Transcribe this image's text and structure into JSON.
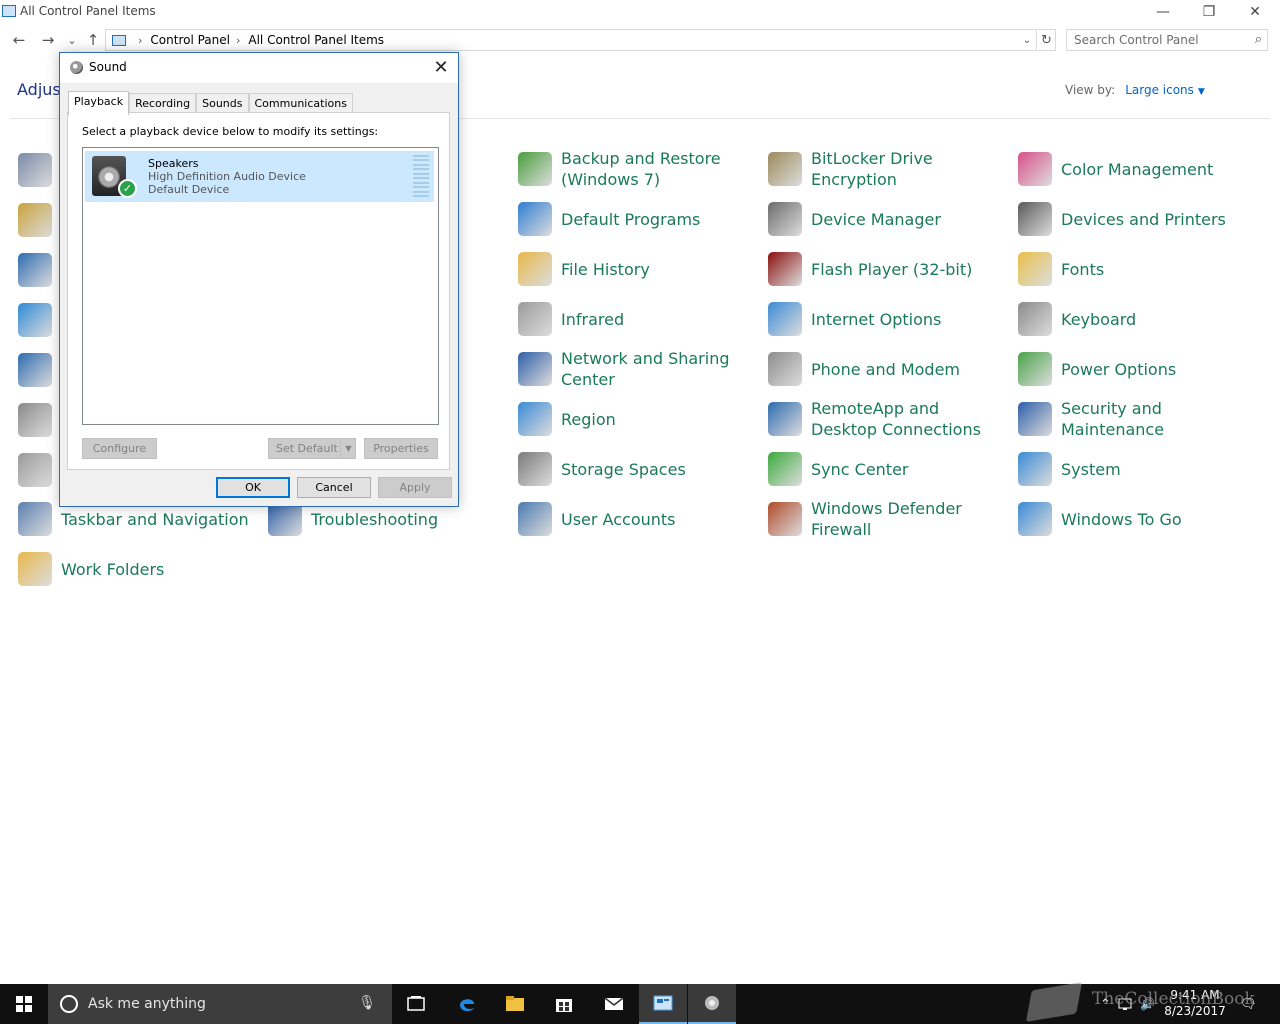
{
  "window": {
    "title": "All Control Panel Items",
    "minimize_glyph": "—",
    "restore_glyph": "❐",
    "close_glyph": "✕"
  },
  "nav": {
    "back_glyph": "←",
    "forward_glyph": "→",
    "recent_glyph": "⌄",
    "up_glyph": "↑",
    "breadcrumb": [
      "Control Panel",
      "All Control Panel Items"
    ],
    "dropdown_glyph": "⌄",
    "refresh_glyph": "↻",
    "search_placeholder": "Search Control Panel",
    "search_glyph": "⌕"
  },
  "header": {
    "adjust_text": "Adjust",
    "view_by_label": "View by:",
    "view_by_value": "Large icons"
  },
  "items": [
    {
      "label": "Backup and Restore (Windows 7)",
      "icon": "backup-restore-icon",
      "color": "#4a9e3c"
    },
    {
      "label": "BitLocker Drive Encryption",
      "icon": "bitlocker-icon",
      "color": "#9a8a5a"
    },
    {
      "label": "Color Management",
      "icon": "color-management-icon",
      "color": "#d94f8a"
    },
    {
      "label": "Default Programs",
      "icon": "default-programs-icon",
      "color": "#2d7dd2"
    },
    {
      "label": "Device Manager",
      "icon": "device-manager-icon",
      "color": "#6c6c6c"
    },
    {
      "label": "Devices and Printers",
      "icon": "devices-printers-icon",
      "color": "#5a5a5a"
    },
    {
      "label": "File History",
      "icon": "file-history-icon",
      "color": "#e8b84a"
    },
    {
      "label": "Flash Player (32-bit)",
      "icon": "flash-player-icon",
      "color": "#8b0f0f"
    },
    {
      "label": "Fonts",
      "icon": "fonts-icon",
      "color": "#e8c04a"
    },
    {
      "label": "Infrared",
      "icon": "infrared-icon",
      "color": "#9a9a9a"
    },
    {
      "label": "Internet Options",
      "icon": "internet-options-icon",
      "color": "#3a8ad6"
    },
    {
      "label": "Keyboard",
      "icon": "keyboard-icon",
      "color": "#8a8a8a"
    },
    {
      "label": "Network and Sharing Center",
      "icon": "network-sharing-icon",
      "color": "#2e5fa8"
    },
    {
      "label": "Phone and Modem",
      "icon": "phone-modem-icon",
      "color": "#8c8c8c"
    },
    {
      "label": "Power Options",
      "icon": "power-options-icon",
      "color": "#4aa34a"
    },
    {
      "label": "Region",
      "icon": "region-icon",
      "color": "#3a8ad6"
    },
    {
      "label": "RemoteApp and Desktop Connections",
      "icon": "remoteapp-icon",
      "color": "#2d6bb0"
    },
    {
      "label": "Security and Maintenance",
      "icon": "security-maintenance-icon",
      "color": "#2e5fa8"
    },
    {
      "label": "Storage Spaces",
      "icon": "storage-spaces-icon",
      "color": "#7a7a7a"
    },
    {
      "label": "Sync Center",
      "icon": "sync-center-icon",
      "color": "#3caa3c"
    },
    {
      "label": "System",
      "icon": "system-icon",
      "color": "#3a8ad6"
    },
    {
      "label": "User Accounts",
      "icon": "user-accounts-icon",
      "color": "#4a7ab0"
    },
    {
      "label": "Windows Defender Firewall",
      "icon": "firewall-icon",
      "color": "#b04a2a"
    },
    {
      "label": "Windows To Go",
      "icon": "windows-to-go-icon",
      "color": "#3a8ad6"
    },
    {
      "label": "Taskbar and Navigation",
      "icon": "taskbar-navigation-icon",
      "color": "#5a7fb0"
    },
    {
      "label": "Troubleshooting",
      "icon": "troubleshooting-icon",
      "color": "#2d5fa8"
    },
    {
      "label": "Work Folders",
      "icon": "work-folders-icon",
      "color": "#e8b84a"
    }
  ],
  "left_column_icons": [
    {
      "icon": "admin-tools-icon",
      "color": "#7a8aa8"
    },
    {
      "icon": "autoplay-icon",
      "color": "#c9a23a"
    },
    {
      "icon": "credential-manager-icon",
      "color": "#2d6bb0"
    },
    {
      "icon": "ease-of-access-icon",
      "color": "#2d8ad6"
    },
    {
      "icon": "language-icon",
      "color": "#2d6bb0"
    },
    {
      "icon": "programs-features-icon",
      "color": "#8a8a8a"
    },
    {
      "icon": "sound-icon",
      "color": "#9a9a9a"
    }
  ],
  "dialog": {
    "title": "Sound",
    "close_glyph": "✕",
    "tabs": [
      "Playback",
      "Recording",
      "Sounds",
      "Communications"
    ],
    "instruction": "Select a playback device below to modify its settings:",
    "device": {
      "name": "Speakers",
      "description": "High Definition Audio Device",
      "status": "Default Device",
      "check_glyph": "✓"
    },
    "configure_label": "Configure",
    "set_default_label": "Set Default",
    "split_arrow_glyph": "▼",
    "properties_label": "Properties",
    "ok_label": "OK",
    "cancel_label": "Cancel",
    "apply_label": "Apply"
  },
  "taskbar": {
    "search_text": "Ask me anything",
    "mic_glyph": "🎙",
    "apps": [
      "task-view-icon",
      "edge-icon",
      "file-explorer-icon",
      "store-icon",
      "mail-icon",
      "control-panel-icon",
      "sound-app-icon"
    ],
    "tray_up_glyph": "⌃",
    "tray_volume_glyph": "🔊",
    "tray_notification_glyph": "🗨",
    "time": "9:41 AM",
    "date": "8/23/2017"
  },
  "watermark": {
    "text": "TheCollectionBook"
  }
}
